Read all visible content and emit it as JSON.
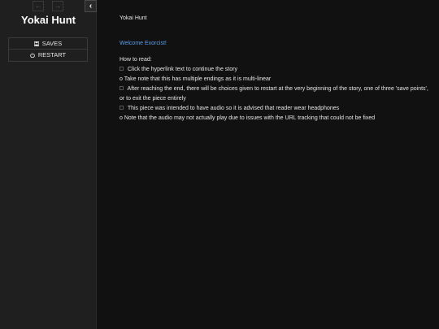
{
  "sidebar": {
    "back_label": "←",
    "forward_label": "→",
    "toggle_label": "‹",
    "story_title": "Yokai Hunt",
    "saves_label": "SAVES",
    "restart_label": "RESTART",
    "saves_icon": "floppy-disk-icon",
    "restart_icon": "power-icon"
  },
  "passage": {
    "title": "Yokai Hunt",
    "welcome": "Welcome Exorcist!",
    "howto": "How to read:",
    "lines": [
      " Click the hyperlink text to continue the story",
      "o Take note that this has multiple endings as it is multi-linear",
      " After reaching the end, there will be choices given to restart at the very beginning of the story, one of three 'save points',",
      "or to exit the piece entirely",
      " This piece was intended to have audio so it is advised that reader wear headphones",
      "o Note that the audio may not actually play due to issues with the URL tracking that could not be fixed"
    ]
  },
  "colors": {
    "background": "#111111",
    "sidebar": "#1f1f1f",
    "link": "#5c9fea",
    "text": "#e6e6e6"
  }
}
